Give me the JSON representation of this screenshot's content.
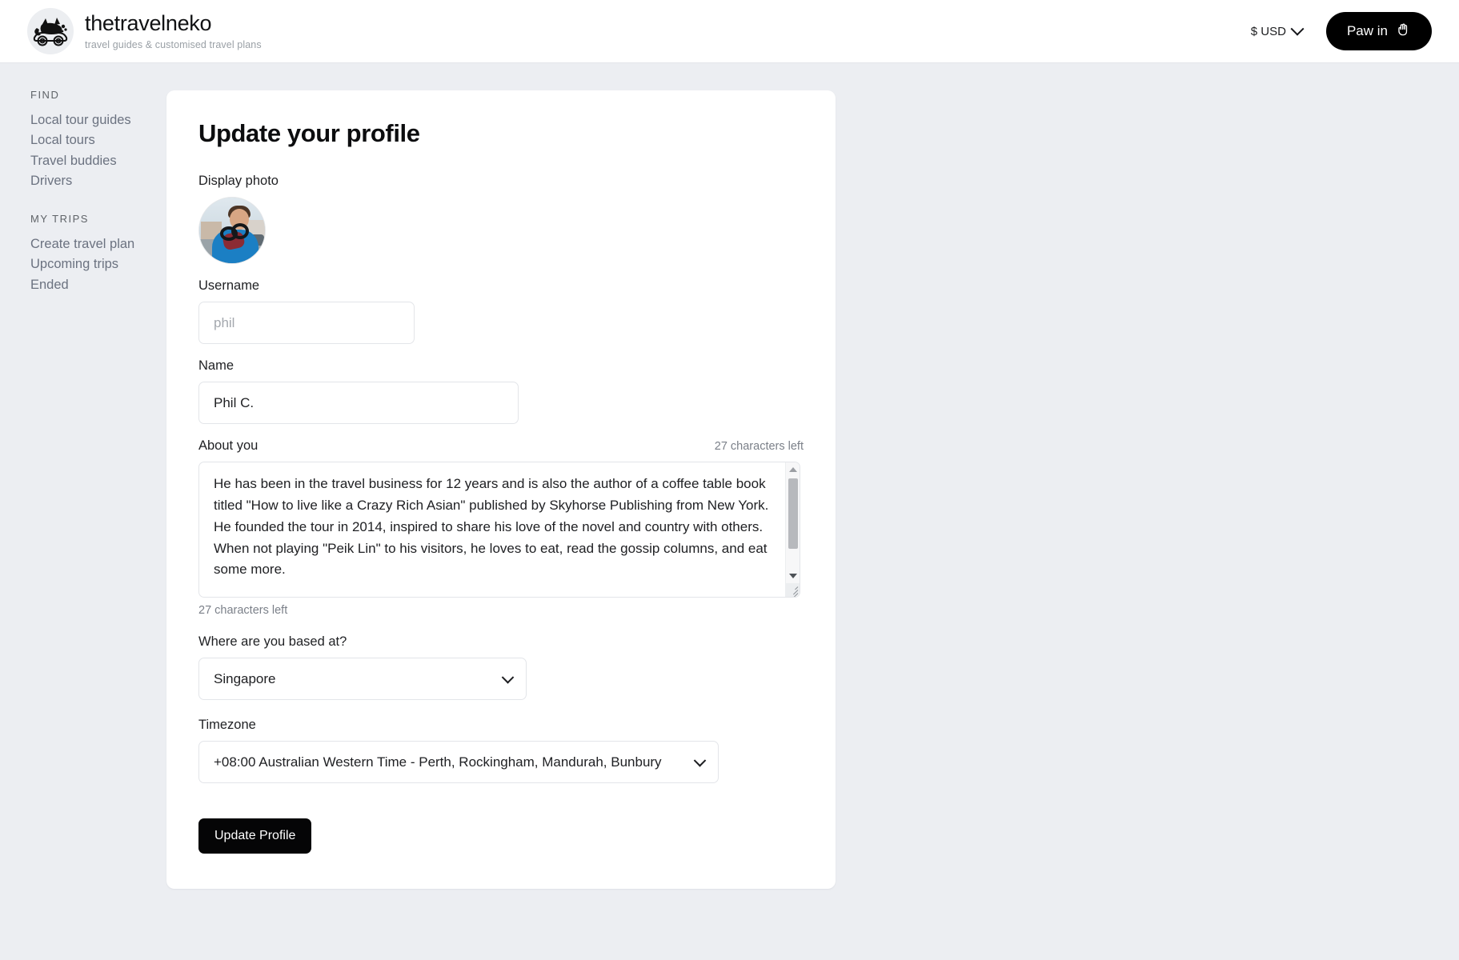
{
  "header": {
    "brand_title": "thetravelneko",
    "brand_tagline": "travel guides & customised travel plans",
    "logo_icon": "cat-in-car-logo",
    "currency_label": "$ USD",
    "currency_chevron_icon": "chevron-down-icon",
    "signin_label": "Paw in",
    "signin_icon": "paw-hand-icon"
  },
  "sidebar": {
    "groups": [
      {
        "heading": "FIND",
        "items": [
          {
            "label": "Local tour guides"
          },
          {
            "label": "Local tours"
          },
          {
            "label": "Travel buddies"
          },
          {
            "label": "Drivers"
          }
        ]
      },
      {
        "heading": "MY TRIPS",
        "items": [
          {
            "label": "Create travel plan"
          },
          {
            "label": "Upcoming trips"
          },
          {
            "label": "Ended"
          }
        ]
      }
    ]
  },
  "main": {
    "title": "Update your profile",
    "display_photo": {
      "label": "Display photo",
      "avatar_alt": "user-profile-photo"
    },
    "username": {
      "label": "Username",
      "value": "",
      "placeholder": "phil"
    },
    "name": {
      "label": "Name",
      "value": "Phil C.",
      "placeholder": ""
    },
    "about": {
      "label": "About you",
      "counter_top": "27 characters left",
      "counter_bottom": "27 characters left",
      "value": "He has been in the travel business for 12 years and is also the author of a coffee table book titled \"How to live like a Crazy Rich Asian\" published by Skyhorse Publishing from New York. He founded the tour in 2014, inspired to share his love of the novel and country with others. When not playing \"Peik Lin\" to his visitors, he loves to eat, read the gossip columns, and eat some more.\n\nPhil and his tours have been recommended and promoted by the Singapore",
      "scrollbar": {
        "up_arrow_icon": "scroll-up-arrow-icon",
        "down_arrow_icon": "scroll-down-arrow-icon",
        "resize_grip_icon": "resize-grip-icon"
      }
    },
    "country": {
      "label": "Where are you based at?",
      "value": "Singapore",
      "options": [
        "Singapore"
      ],
      "chevron_icon": "chevron-down-icon"
    },
    "timezone": {
      "label": "Timezone",
      "value": "+08:00 Australian Western Time - Perth, Rockingham, Mandurah, Bunbury",
      "options": [
        "+08:00 Australian Western Time - Perth, Rockingham, Mandurah, Bunbury"
      ],
      "chevron_icon": "chevron-down-icon"
    },
    "submit_label": "Update Profile"
  },
  "colors": {
    "page_background": "#eceef2",
    "card_background": "#ffffff",
    "accent_dark": "#000000",
    "muted_text": "#6b7280",
    "border": "#e3e5e9"
  }
}
